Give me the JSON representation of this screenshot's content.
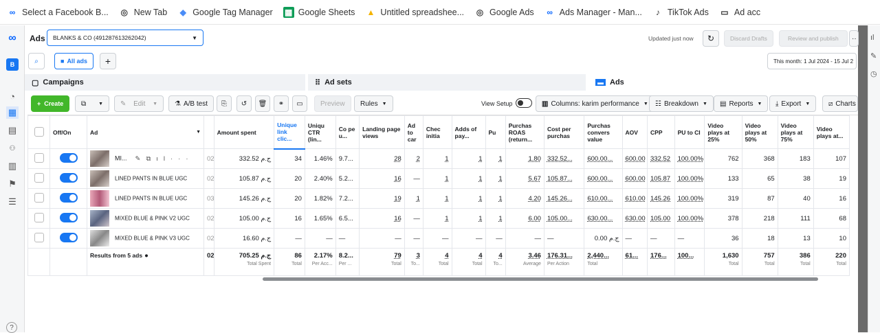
{
  "bookmarks": [
    {
      "label": "Select a Facebook B...",
      "icon": "meta-icon"
    },
    {
      "label": "New Tab",
      "icon": "chrome-icon"
    },
    {
      "label": "Google Tag Manager",
      "icon": "gtm-icon"
    },
    {
      "label": "Google Sheets",
      "icon": "sheets-icon"
    },
    {
      "label": "Untitled spreadshee...",
      "icon": "ads-icon"
    },
    {
      "label": "Google Ads",
      "icon": "chrome-icon"
    },
    {
      "label": "Ads Manager - Man...",
      "icon": "meta-icon"
    },
    {
      "label": "TikTok Ads",
      "icon": "tiktok-icon"
    },
    {
      "label": "Ad acc",
      "icon": "folder-icon"
    }
  ],
  "header": {
    "section": "Ads",
    "account": "BLANKS & CO (491287613262042)",
    "updated": "Updated just now",
    "discard": "Discard Drafts",
    "review": "Review and publish",
    "date_range": "This month: 1 Jul 2024 - 15 Jul 2"
  },
  "filter": {
    "all_ads": "All ads"
  },
  "tabs": {
    "campaigns": "Campaigns",
    "adsets": "Ad sets",
    "ads": "Ads"
  },
  "toolbar": {
    "create": "Create",
    "edit": "Edit",
    "abtest": "A/B test",
    "preview": "Preview",
    "rules": "Rules",
    "view_setup": "View Setup",
    "columns": "Columns: karim performance",
    "breakdown": "Breakdown",
    "reports": "Reports",
    "export": "Export",
    "charts": "Charts"
  },
  "columns": [
    "Off/On",
    "Ad",
    "Amount spent",
    "Unique link clic...",
    "Uniqu CTR (lin...",
    "Co pe u...",
    "Landing page views",
    "Ad to car",
    "Chec initia",
    "Adds of pay...",
    "Pu",
    "Purchas ROAS (return...",
    "Cost per purchas",
    "Purchas convers value",
    "AOV",
    "CPP",
    "PU to CI",
    "Video plays at 25%",
    "Video plays at 50%",
    "Video plays at 75%",
    "Video plays at..."
  ],
  "rows": [
    {
      "name": "MI...",
      "spent": "332.52 ج.م",
      "c1": "34",
      "ctr": "1.46%",
      "cpu": "9.7...",
      "lpv": "28",
      "atc": "2",
      "ci": "1",
      "ap": "1",
      "pu": "1",
      "roas": "1.80",
      "cpp": "332.52...",
      "val": "600.00...",
      "aov": "600.00",
      "cpp2": "332.52",
      "puci": "100.00%",
      "v25": "762",
      "v50": "368",
      "v75": "183",
      "v95": "107",
      "p": "02"
    },
    {
      "name": "LINED PANTS IN BLUE UGC",
      "spent": "105.87 ج.م",
      "c1": "20",
      "ctr": "2.40%",
      "cpu": "5.2...",
      "lpv": "16",
      "atc": "—",
      "ci": "1",
      "ap": "1",
      "pu": "1",
      "roas": "5.67",
      "cpp": "105.87...",
      "val": "600.00...",
      "aov": "600.00",
      "cpp2": "105.87",
      "puci": "100.00%",
      "v25": "133",
      "v50": "65",
      "v75": "38",
      "v95": "19",
      "p": "02"
    },
    {
      "name": "LINED PANTS IN BLUE UGC",
      "spent": "145.26 ج.م",
      "c1": "20",
      "ctr": "1.82%",
      "cpu": "7.2...",
      "lpv": "19",
      "atc": "1",
      "ci": "1",
      "ap": "1",
      "pu": "1",
      "roas": "4.20",
      "cpp": "145.26...",
      "val": "610.00...",
      "aov": "610.00",
      "cpp2": "145.26",
      "puci": "100.00%",
      "v25": "319",
      "v50": "87",
      "v75": "40",
      "v95": "16",
      "p": "03"
    },
    {
      "name": "MIXED BLUE & PINK V2 UGC",
      "spent": "105.00 ج.م",
      "c1": "16",
      "ctr": "1.65%",
      "cpu": "6.5...",
      "lpv": "16",
      "atc": "—",
      "ci": "1",
      "ap": "1",
      "pu": "1",
      "roas": "6.00",
      "cpp": "105.00...",
      "val": "630.00...",
      "aov": "630.00",
      "cpp2": "105.00",
      "puci": "100.00%",
      "v25": "378",
      "v50": "218",
      "v75": "111",
      "v95": "68",
      "p": "02"
    },
    {
      "name": "MIXED BLUE & PINK V3 UGC",
      "spent": "16.60 ج.م",
      "c1": "—",
      "ctr": "—",
      "cpu": "—",
      "lpv": "—",
      "atc": "—",
      "ci": "—",
      "ap": "—",
      "pu": "—",
      "roas": "—",
      "cpp": "—",
      "val": "0.00 ج.م",
      "aov": "—",
      "cpp2": "—",
      "puci": "—",
      "v25": "36",
      "v50": "18",
      "v75": "13",
      "v95": "10",
      "p": "02"
    }
  ],
  "summary": {
    "label": "Results from 5 ads",
    "spent": "705.25 ج.م",
    "spent_sub": "Total Spent",
    "c1": "86",
    "ctr": "2.17%",
    "cpu": "8.2...",
    "lpv": "79",
    "atc": "3",
    "ci": "4",
    "ap": "4",
    "pu": "4",
    "roas": "3.46",
    "cpp": "176.31...",
    "val": "2,440...",
    "aov": "61...",
    "cpp2": "176...",
    "puci": "100...",
    "v25": "1,630",
    "v50": "757",
    "v75": "386",
    "v95": "220",
    "t_total": "Total",
    "t_peracc": "Per Acc...",
    "t_per": "Per ...",
    "t_to": "To...",
    "t_avg": "Average",
    "t_peraction": "Per Action",
    "p": "02"
  }
}
